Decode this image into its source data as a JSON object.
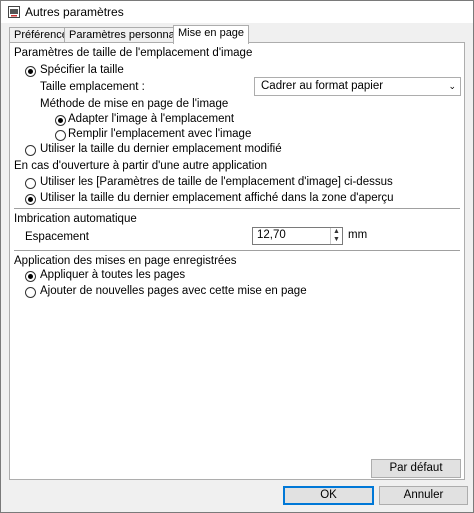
{
  "window": {
    "title": "Autres paramètres"
  },
  "tabs": [
    {
      "label": "Préférences"
    },
    {
      "label": "Paramètres personnalisés"
    },
    {
      "label": "Mise en page"
    }
  ],
  "slot_size": {
    "heading": "Paramètres de taille de l'emplacement d'image",
    "specify_size": "Spécifier la taille",
    "size_label": "Taille emplacement :",
    "size_select": "Cadrer au format papier",
    "method_label": "Méthode de mise en page de l'image",
    "fit_image": "Adapter l'image à l'emplacement",
    "fill_slot": "Remplir l'emplacement avec l'image",
    "use_last_modified": "Utiliser la taille du dernier emplacement modifié"
  },
  "open_other_app": {
    "heading": "En cas d'ouverture à partir d'une autre application",
    "use_params_above": "Utiliser les [Paramètres de taille de l'emplacement d'image] ci-dessus",
    "use_last_preview": "Utiliser la taille du dernier emplacement affiché dans la zone d'aperçu"
  },
  "auto_nesting": {
    "heading": "Imbrication automatique",
    "spacing_label": "Espacement",
    "spacing_value": "12,70",
    "unit": "mm"
  },
  "saved_layouts": {
    "heading": "Application des mises en page enregistrées",
    "apply_all": "Appliquer à toutes les pages",
    "add_new_pages": "Ajouter de nouvelles pages avec cette mise en page"
  },
  "buttons": {
    "default": "Par défaut",
    "ok": "OK",
    "cancel": "Annuler"
  }
}
